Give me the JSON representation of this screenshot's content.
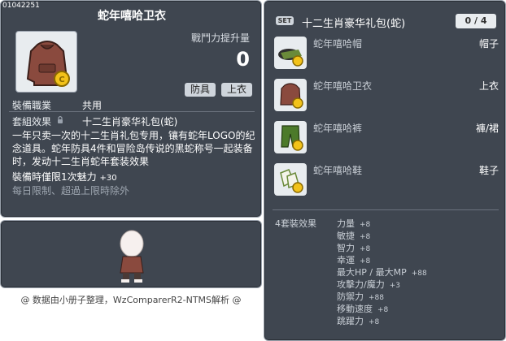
{
  "item": {
    "id": "01042251",
    "title": "蛇年嘻哈卫衣",
    "power_label": "戰鬥力提升量",
    "power_value": "0",
    "buttons": [
      "防具",
      "上衣"
    ],
    "job_label": "裝備職業",
    "job_value": "共用",
    "set_effect_label": "套組效果",
    "set_effect_value": "十二生肖豪华礼包(蛇)",
    "description": "一年只卖一次的十二生肖礼包专用，镶有蛇年LOGO的纪念道具。蛇年防具4件和冒险岛传说的黑蛇称号一起装备时，发动十二生肖蛇年套装效果",
    "stat_text": "裝備時僅限1次魅力",
    "stat_value": "+30",
    "restriction": "每日限制、超過上限時除外"
  },
  "credit": "@ 数据由小册子整理，WzComparerR2-NTMS解析 @",
  "set": {
    "badge": "SET",
    "name": "十二生肖豪华礼包(蛇)",
    "count": "0 / 4",
    "pieces": [
      {
        "name": "蛇年嘻哈帽",
        "slot": "帽子",
        "icon": "hat-icon"
      },
      {
        "name": "蛇年嘻哈卫衣",
        "slot": "上衣",
        "icon": "hoodie-icon"
      },
      {
        "name": "蛇年嘻哈裤",
        "slot": "褲/裙",
        "icon": "pants-icon"
      },
      {
        "name": "蛇年嘻哈鞋",
        "slot": "鞋子",
        "icon": "shoes-icon"
      }
    ],
    "effect_label": "4套裝效果",
    "effects": [
      {
        "label": "力量",
        "value": "+8"
      },
      {
        "label": "敏捷",
        "value": "+8"
      },
      {
        "label": "智力",
        "value": "+8"
      },
      {
        "label": "幸運",
        "value": "+8"
      },
      {
        "label": "最大HP / 最大MP",
        "value": "+88"
      },
      {
        "label": "攻擊力/魔力",
        "value": "+3"
      },
      {
        "label": "防禦力",
        "value": "+88"
      },
      {
        "label": "移動速度",
        "value": "+8"
      },
      {
        "label": "跳躍力",
        "value": "+8"
      }
    ]
  },
  "colors": {
    "panel_bg": "#3f4650",
    "panel_border": "#9aa2ad",
    "coin_gold": "#f2c21a",
    "hoodie_brown": "#8a4a3e"
  }
}
